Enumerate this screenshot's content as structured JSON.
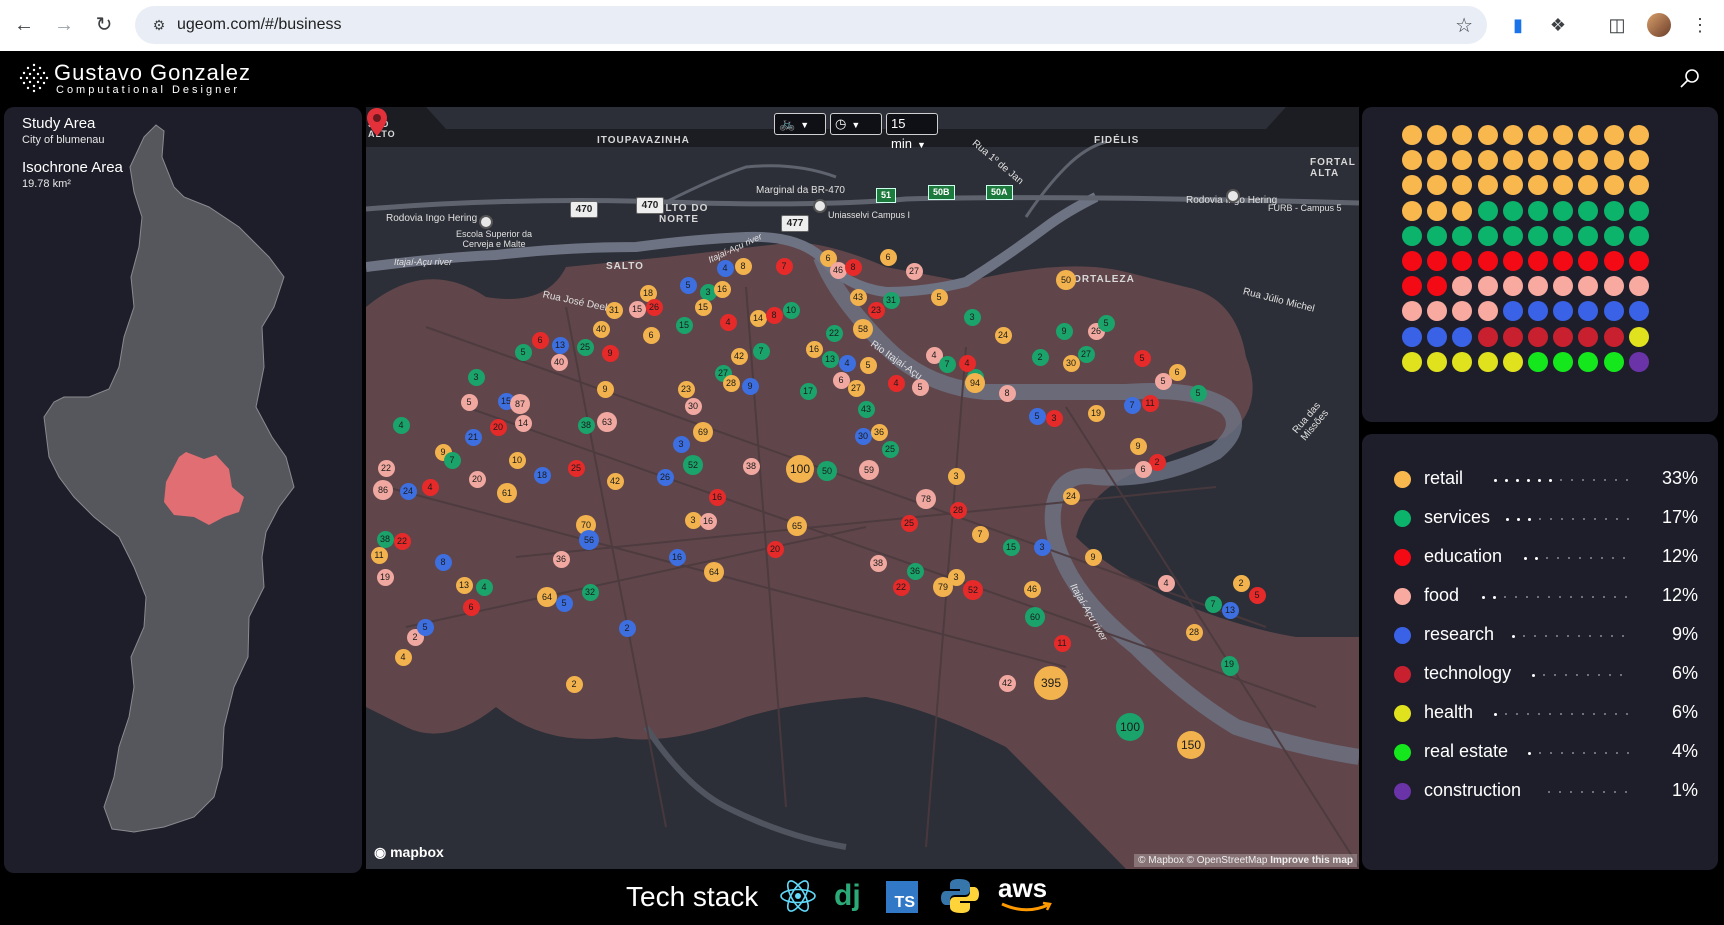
{
  "browser": {
    "url": "ugeom.com/#/business"
  },
  "site": {
    "name": "Gustavo Gonzalez",
    "subtitle": "Computational Designer"
  },
  "left_panel": {
    "study_area_title": "Study Area",
    "study_area_value": "City of blumenau",
    "isochrone_title": "Isochrone Area",
    "isochrone_value": "19.78 km²"
  },
  "map": {
    "controls": {
      "mode_icon": "bicycle-icon",
      "time_icon": "clock-icon",
      "duration": "15 min"
    },
    "place_labels": [
      "ITOUPAVAZINHA",
      "FIDÉLIS",
      "SALTO DO NORTE",
      "SALTO",
      "FORTALEZA",
      "FORTAL ALTA",
      "STO ALTO"
    ],
    "road_labels": [
      "Rodovia Ingo Hering",
      "Marginal da BR-470",
      "Rua 1º de Jan",
      "Rodovia Ingo Hering",
      "FURB - Campus 5",
      "Escola Superior da Cerveja e Malte",
      "Uniasselvi Campus I",
      "Itajaí-Açu river",
      "Itajaí-Açu river",
      "Rua José Deeke",
      "Rio Itajaí-Açu",
      "Rua Júlio Michel",
      "Rua das Missões",
      "Itajaí-Açu river"
    ],
    "shields": [
      "470",
      "470",
      "477"
    ],
    "green_shields": [
      "51",
      "50B",
      "50A"
    ],
    "brand": "mapbox",
    "attribution": "© Mapbox © OpenStreetMap",
    "improve": "Improve this map",
    "markers": [
      {
        "v": "4",
        "c": "#3d6fe0"
      },
      {
        "v": "8",
        "c": "#f2b24d"
      },
      {
        "v": "7",
        "c": "#e62a2a"
      },
      {
        "v": "6",
        "c": "#f2b24d"
      },
      {
        "v": "46",
        "c": "#f0a8a0"
      },
      {
        "v": "8",
        "c": "#e62a2a"
      },
      {
        "v": "6",
        "c": "#f2b24d"
      },
      {
        "v": "27",
        "c": "#f0a8a0"
      },
      {
        "v": "18",
        "c": "#f2b24d"
      },
      {
        "v": "5",
        "c": "#3d6fe0"
      },
      {
        "v": "3",
        "c": "#1aa36b"
      },
      {
        "v": "16",
        "c": "#f2b24d"
      },
      {
        "v": "31",
        "c": "#f2b24d"
      },
      {
        "v": "15",
        "c": "#f0a8a0"
      },
      {
        "v": "26",
        "c": "#e62a2a"
      },
      {
        "v": "15",
        "c": "#f2b24d"
      },
      {
        "v": "40",
        "c": "#f2b24d"
      },
      {
        "v": "6",
        "c": "#f2b24d"
      },
      {
        "v": "15",
        "c": "#1aa36b"
      },
      {
        "v": "4",
        "c": "#e62a2a"
      },
      {
        "v": "14",
        "c": "#f2b24d"
      },
      {
        "v": "8",
        "c": "#e62a2a"
      },
      {
        "v": "10",
        "c": "#1aa36b"
      },
      {
        "v": "43",
        "c": "#f2b24d"
      },
      {
        "v": "23",
        "c": "#e62a2a"
      },
      {
        "v": "31",
        "c": "#1aa36b"
      },
      {
        "v": "5",
        "c": "#f2b24d"
      },
      {
        "v": "58",
        "c": "#f2b24d"
      },
      {
        "v": "22",
        "c": "#1aa36b"
      },
      {
        "v": "16",
        "c": "#f2b24d"
      },
      {
        "v": "6",
        "c": "#e62a2a"
      },
      {
        "v": "13",
        "c": "#3d6fe0"
      },
      {
        "v": "25",
        "c": "#1aa36b"
      },
      {
        "v": "9",
        "c": "#e62a2a"
      },
      {
        "v": "5",
        "c": "#1aa36b"
      },
      {
        "v": "40",
        "c": "#f0a8a0"
      },
      {
        "v": "42",
        "c": "#f2b24d"
      },
      {
        "v": "7",
        "c": "#1aa36b"
      },
      {
        "v": "27",
        "c": "#1aa36b"
      },
      {
        "v": "13",
        "c": "#1aa36b"
      },
      {
        "v": "4",
        "c": "#3d6fe0"
      },
      {
        "v": "5",
        "c": "#f2b24d"
      },
      {
        "v": "3",
        "c": "#1aa36b"
      },
      {
        "v": "9",
        "c": "#f2b24d"
      },
      {
        "v": "28",
        "c": "#f2b24d"
      },
      {
        "v": "9",
        "c": "#3d6fe0"
      },
      {
        "v": "23",
        "c": "#f2b24d"
      },
      {
        "v": "30",
        "c": "#f0a8a0"
      },
      {
        "v": "6",
        "c": "#f0a8a0"
      },
      {
        "v": "27",
        "c": "#f2b24d"
      },
      {
        "v": "4",
        "c": "#e62a2a"
      },
      {
        "v": "17",
        "c": "#1aa36b"
      },
      {
        "v": "5",
        "c": "#f0a8a0"
      },
      {
        "v": "15",
        "c": "#1aa36b"
      },
      {
        "v": "4",
        "c": "#f0a8a0"
      },
      {
        "v": "7",
        "c": "#1aa36b"
      },
      {
        "v": "24",
        "c": "#f2b24d"
      },
      {
        "v": "4",
        "c": "#e62a2a"
      },
      {
        "v": "94",
        "c": "#f2b24d"
      },
      {
        "v": "8",
        "c": "#f0a8a0"
      },
      {
        "v": "9",
        "c": "#1aa36b"
      },
      {
        "v": "2",
        "c": "#1aa36b"
      },
      {
        "v": "26",
        "c": "#f0a8a0"
      },
      {
        "v": "30",
        "c": "#f2b24d"
      },
      {
        "v": "27",
        "c": "#1aa36b"
      },
      {
        "v": "5",
        "c": "#1aa36b"
      },
      {
        "v": "5",
        "c": "#e62a2a"
      },
      {
        "v": "6",
        "c": "#f2b24d"
      },
      {
        "v": "5",
        "c": "#f0a8a0"
      },
      {
        "v": "5",
        "c": "#1aa36b"
      },
      {
        "v": "50",
        "c": "#f2b24d"
      },
      {
        "v": "3",
        "c": "#1aa36b"
      },
      {
        "v": "15",
        "c": "#3d6fe0"
      },
      {
        "v": "87",
        "c": "#f0a8a0"
      },
      {
        "v": "14",
        "c": "#f0a8a0"
      },
      {
        "v": "5",
        "c": "#f0a8a0"
      },
      {
        "v": "20",
        "c": "#e62a2a"
      },
      {
        "v": "21",
        "c": "#3d6fe0"
      },
      {
        "v": "4",
        "c": "#1aa36b"
      },
      {
        "v": "38",
        "c": "#1aa36b"
      },
      {
        "v": "63",
        "c": "#f0a8a0"
      },
      {
        "v": "69",
        "c": "#f2b24d"
      },
      {
        "v": "3",
        "c": "#3d6fe0"
      },
      {
        "v": "43",
        "c": "#1aa36b"
      },
      {
        "v": "30",
        "c": "#3d6fe0"
      },
      {
        "v": "36",
        "c": "#f2b24d"
      },
      {
        "v": "25",
        "c": "#1aa36b"
      },
      {
        "v": "3",
        "c": "#f2b24d"
      },
      {
        "v": "5",
        "c": "#3d6fe0"
      },
      {
        "v": "3",
        "c": "#e62a2a"
      },
      {
        "v": "19",
        "c": "#f2b24d"
      },
      {
        "v": "7",
        "c": "#3d6fe0"
      },
      {
        "v": "11",
        "c": "#e62a2a"
      },
      {
        "v": "9",
        "c": "#f2b24d"
      },
      {
        "v": "2",
        "c": "#e62a2a"
      },
      {
        "v": "6",
        "c": "#f0a8a0"
      },
      {
        "v": "22",
        "c": "#f0a8a0"
      },
      {
        "v": "86",
        "c": "#f0a8a0"
      },
      {
        "v": "24",
        "c": "#3d6fe0"
      },
      {
        "v": "4",
        "c": "#e62a2a"
      },
      {
        "v": "9",
        "c": "#f2b24d"
      },
      {
        "v": "7",
        "c": "#1aa36b"
      },
      {
        "v": "10",
        "c": "#f2b24d"
      },
      {
        "v": "20",
        "c": "#f0a8a0"
      },
      {
        "v": "61",
        "c": "#f2b24d"
      },
      {
        "v": "18",
        "c": "#3d6fe0"
      },
      {
        "v": "25",
        "c": "#e62a2a"
      },
      {
        "v": "42",
        "c": "#f2b24d"
      },
      {
        "v": "26",
        "c": "#3d6fe0"
      },
      {
        "v": "52",
        "c": "#1aa36b"
      },
      {
        "v": "16",
        "c": "#e62a2a"
      },
      {
        "v": "38",
        "c": "#f0a8a0"
      },
      {
        "v": "100",
        "c": "#f2b24d"
      },
      {
        "v": "50",
        "c": "#1aa36b"
      },
      {
        "v": "59",
        "c": "#f0a8a0"
      },
      {
        "v": "3",
        "c": "#f2b24d"
      },
      {
        "v": "78",
        "c": "#f0a8a0"
      },
      {
        "v": "28",
        "c": "#e62a2a"
      },
      {
        "v": "24",
        "c": "#f2b24d"
      },
      {
        "v": "38",
        "c": "#1aa36b"
      },
      {
        "v": "22",
        "c": "#e62a2a"
      },
      {
        "v": "11",
        "c": "#f2b24d"
      },
      {
        "v": "19",
        "c": "#f0a8a0"
      },
      {
        "v": "8",
        "c": "#3d6fe0"
      },
      {
        "v": "36",
        "c": "#f0a8a0"
      },
      {
        "v": "70",
        "c": "#f2b24d"
      },
      {
        "v": "56",
        "c": "#3d6fe0"
      },
      {
        "v": "3",
        "c": "#f2b24d"
      },
      {
        "v": "16",
        "c": "#f0a8a0"
      },
      {
        "v": "65",
        "c": "#f2b24d"
      },
      {
        "v": "20",
        "c": "#e62a2a"
      },
      {
        "v": "25",
        "c": "#e62a2a"
      },
      {
        "v": "7",
        "c": "#f2b24d"
      },
      {
        "v": "15",
        "c": "#1aa36b"
      },
      {
        "v": "3",
        "c": "#3d6fe0"
      },
      {
        "v": "9",
        "c": "#f2b24d"
      },
      {
        "v": "13",
        "c": "#f2b24d"
      },
      {
        "v": "4",
        "c": "#1aa36b"
      },
      {
        "v": "6",
        "c": "#e62a2a"
      },
      {
        "v": "64",
        "c": "#f2b24d"
      },
      {
        "v": "5",
        "c": "#3d6fe0"
      },
      {
        "v": "32",
        "c": "#1aa36b"
      },
      {
        "v": "16",
        "c": "#3d6fe0"
      },
      {
        "v": "64",
        "c": "#f2b24d"
      },
      {
        "v": "38",
        "c": "#f0a8a0"
      },
      {
        "v": "36",
        "c": "#1aa36b"
      },
      {
        "v": "22",
        "c": "#e62a2a"
      },
      {
        "v": "79",
        "c": "#f2b24d"
      },
      {
        "v": "52",
        "c": "#e62a2a"
      },
      {
        "v": "46",
        "c": "#f2b24d"
      },
      {
        "v": "60",
        "c": "#1aa36b"
      },
      {
        "v": "11",
        "c": "#e62a2a"
      },
      {
        "v": "4",
        "c": "#f0a8a0"
      },
      {
        "v": "2",
        "c": "#f2b24d"
      },
      {
        "v": "5",
        "c": "#e62a2a"
      },
      {
        "v": "7",
        "c": "#1aa36b"
      },
      {
        "v": "13",
        "c": "#3d6fe0"
      },
      {
        "v": "28",
        "c": "#f2b24d"
      },
      {
        "v": "11",
        "c": "#1aa36b"
      },
      {
        "v": "2",
        "c": "#f0a8a0"
      },
      {
        "v": "4",
        "c": "#f2b24d"
      },
      {
        "v": "5",
        "c": "#3d6fe0"
      },
      {
        "v": "2",
        "c": "#3d6fe0"
      },
      {
        "v": "2",
        "c": "#f2b24d"
      },
      {
        "v": "42",
        "c": "#f0a8a0"
      },
      {
        "v": "395",
        "c": "#f2b24d"
      },
      {
        "v": "19",
        "c": "#1aa36b"
      },
      {
        "v": "100",
        "c": "#1aa36b"
      },
      {
        "v": "150",
        "c": "#f2b24d"
      }
    ]
  },
  "waffle": {
    "rows": [
      [
        "#f8b84e",
        "#f8b84e",
        "#f8b84e",
        "#f8b84e",
        "#f8b84e",
        "#f8b84e",
        "#f8b84e",
        "#f8b84e",
        "#f8b84e",
        "#f8b84e"
      ],
      [
        "#f8b84e",
        "#f8b84e",
        "#f8b84e",
        "#f8b84e",
        "#f8b84e",
        "#f8b84e",
        "#f8b84e",
        "#f8b84e",
        "#f8b84e",
        "#f8b84e"
      ],
      [
        "#f8b84e",
        "#f8b84e",
        "#f8b84e",
        "#f8b84e",
        "#f8b84e",
        "#f8b84e",
        "#f8b84e",
        "#f8b84e",
        "#f8b84e",
        "#f8b84e"
      ],
      [
        "#f8b84e",
        "#f8b84e",
        "#f8b84e",
        "#0cb36b",
        "#0cb36b",
        "#0cb36b",
        "#0cb36b",
        "#0cb36b",
        "#0cb36b",
        "#0cb36b"
      ],
      [
        "#0cb36b",
        "#0cb36b",
        "#0cb36b",
        "#0cb36b",
        "#0cb36b",
        "#0cb36b",
        "#0cb36b",
        "#0cb36b",
        "#0cb36b",
        "#0cb36b"
      ],
      [
        "#f40a14",
        "#f40a14",
        "#f40a14",
        "#f40a14",
        "#f40a14",
        "#f40a14",
        "#f40a14",
        "#f40a14",
        "#f40a14",
        "#f40a14"
      ],
      [
        "#f40a14",
        "#f40a14",
        "#f8aaa0",
        "#f8aaa0",
        "#f8aaa0",
        "#f8aaa0",
        "#f8aaa0",
        "#f8aaa0",
        "#f8aaa0",
        "#f8aaa0"
      ],
      [
        "#f8aaa0",
        "#f8aaa0",
        "#f8aaa0",
        "#f8aaa0",
        "#3a62e6",
        "#3a62e6",
        "#3a62e6",
        "#3a62e6",
        "#3a62e6",
        "#3a62e6"
      ],
      [
        "#3a62e6",
        "#3a62e6",
        "#3a62e6",
        "#c8202e",
        "#c8202e",
        "#c8202e",
        "#c8202e",
        "#c8202e",
        "#c8202e",
        "#e0e21e"
      ],
      [
        "#e0e21e",
        "#e0e21e",
        "#e0e21e",
        "#e0e21e",
        "#e0e21e",
        "#14e81c",
        "#14e81c",
        "#14e81c",
        "#14e81c",
        "#6a34a8"
      ]
    ]
  },
  "legend": [
    {
      "label": "retail",
      "pct": "33%",
      "color": "#f8b84e",
      "dots": 6
    },
    {
      "label": "services",
      "pct": "17%",
      "color": "#0cb36b",
      "dots": 3
    },
    {
      "label": "education",
      "pct": "12%",
      "color": "#f40a14",
      "dots": 2
    },
    {
      "label": "food",
      "pct": "12%",
      "color": "#f8aaa0",
      "dots": 2
    },
    {
      "label": "research",
      "pct": "9%",
      "color": "#3a62e6",
      "dots": 1
    },
    {
      "label": "technology",
      "pct": "6%",
      "color": "#c8202e",
      "dots": 1
    },
    {
      "label": "health",
      "pct": "6%",
      "color": "#e0e21e",
      "dots": 1
    },
    {
      "label": "real estate",
      "pct": "4%",
      "color": "#14e81c",
      "dots": 1
    },
    {
      "label": "construction",
      "pct": "1%",
      "color": "#6a34a8",
      "dots": 0
    }
  ],
  "footer": {
    "title": "Tech stack",
    "icons": [
      "react-icon",
      "django-icon",
      "typescript-icon",
      "python-icon",
      "aws-icon"
    ],
    "django_text": "dj",
    "ts_text": "TS",
    "aws_text": "aws"
  }
}
